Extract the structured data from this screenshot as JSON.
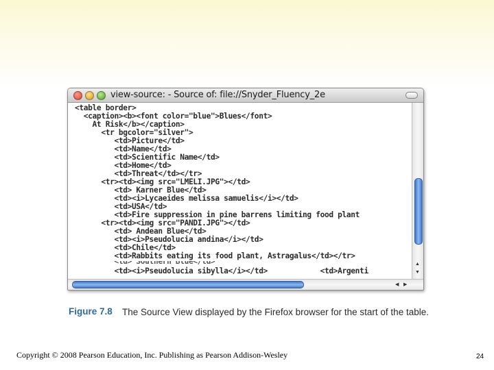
{
  "window": {
    "title": "view-source: - Source of: file://Snyder_Fluency_2e"
  },
  "source_lines": [
    {
      "text": "<table border>"
    },
    {
      "text": "  <caption><b><font color=\"blue\">Blues</font>"
    },
    {
      "text": "    At Risk</b></caption>"
    },
    {
      "text": "      <tr bgcolor=\"silver\">"
    },
    {
      "text": "         <td>Picture</td>"
    },
    {
      "text": "         <td>Name</td>"
    },
    {
      "text": "         <td>Scientific Name</td>"
    },
    {
      "text": "         <td>Home</td>"
    },
    {
      "text": "         <td>Threat</td></tr>"
    },
    {
      "text": "      <tr><td><img src=\"LMELI.JPG\"></td>"
    },
    {
      "text": "         <td> Karner Blue</td>"
    },
    {
      "text": "         <td><i>Lycaeides melissa samuelis</i></td>"
    },
    {
      "text": "         <td>USA</td>"
    },
    {
      "text": "         <td>Fire suppression in pine barrens limiting food plant"
    },
    {
      "text": "      <tr><td><img src=\"PANDI.JPG\"></td>"
    },
    {
      "text": "         <td> Andean Blue</td>"
    },
    {
      "text": "         <td><i>Pseudolucia andina</i></td>"
    },
    {
      "text": "         <td>Chile</td>"
    },
    {
      "text": "         <td>Rabbits eating its food plant, Astragalus</td></tr>"
    },
    {
      "text": "         <td> Southern Blue</td>"
    },
    {
      "text": "         <td><i>Pseudolucia sibylla</i></td>            <td>Argenti"
    }
  ],
  "figure": {
    "number": "Figure 7.8",
    "caption": "The Source View displayed by the Firefox browser for the start of the table."
  },
  "footer": {
    "copyright": "Copyright © 2008 Pearson Education, Inc. Publishing as Pearson Addison-Wesley",
    "page_number": "24"
  }
}
